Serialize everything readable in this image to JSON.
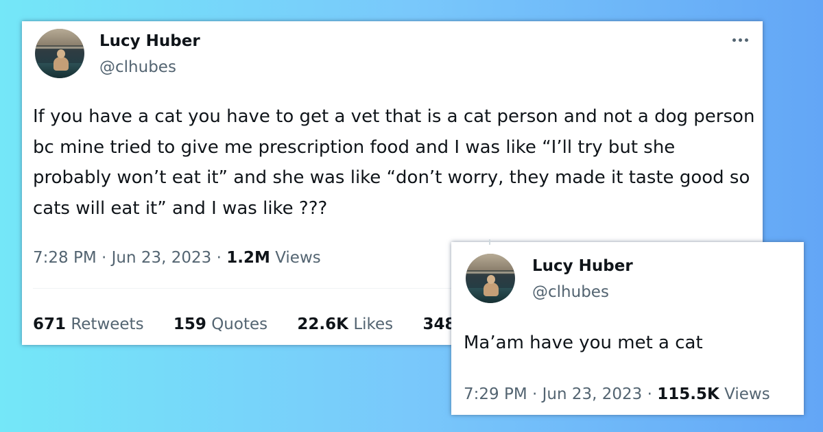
{
  "main_tweet": {
    "author": {
      "name": "Lucy Huber",
      "handle": "@clhubes"
    },
    "text": "If you have a cat you have to get a vet that is a cat person and not a dog person bc mine tried to give me prescription food and I was like “I’ll try but she probably won’t eat it” and she was like “don’t worry, they made it taste good so cats will eat it” and I was like ???",
    "time": "7:28 PM",
    "separator": "·",
    "date": "Jun 23, 2023",
    "views_count": "1.2M",
    "views_label": "Views",
    "stats": {
      "retweets_count": "671",
      "retweets_label": "Retweets",
      "quotes_count": "159",
      "quotes_label": "Quotes",
      "likes_count": "22.6K",
      "likes_label": "Likes",
      "bookmarks_count": "348"
    },
    "more_icon": "more-horizontal-icon"
  },
  "reply_tweet": {
    "author": {
      "name": "Lucy Huber",
      "handle": "@clhubes"
    },
    "text": "Ma’am have you met a cat",
    "time": "7:29 PM",
    "separator": "·",
    "date": "Jun 23, 2023",
    "views_count": "115.5K",
    "views_label": "Views"
  },
  "colors": {
    "background_start": "#74e7f8",
    "background_end": "#63a6f6",
    "text_primary": "#0f1419",
    "text_secondary": "#536471",
    "card": "#ffffff"
  }
}
